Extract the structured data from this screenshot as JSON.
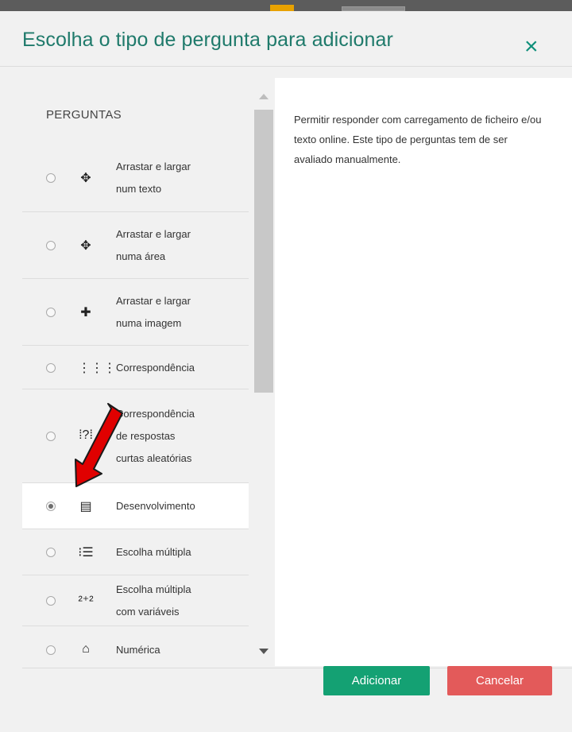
{
  "dialog": {
    "title": "Escolha o tipo de pergunta para adicionar",
    "close_symbol": "×"
  },
  "left_pane": {
    "section_title": "PERGUNTAS",
    "items": [
      {
        "label": "Arrastar e largar num texto",
        "lines": [
          "Arrastar e largar",
          "num texto"
        ],
        "icon": "move-icon",
        "icon_glyph": "✥",
        "selected": false
      },
      {
        "label": "Arrastar e largar numa área",
        "lines": [
          "Arrastar e largar",
          "numa área"
        ],
        "icon": "move-icon",
        "icon_glyph": "✥",
        "selected": false
      },
      {
        "label": "Arrastar e largar numa imagem",
        "lines": [
          "Arrastar e largar",
          "numa imagem"
        ],
        "icon": "move-icon",
        "icon_glyph": "✚",
        "selected": false
      },
      {
        "label": "Correspondência",
        "lines": [
          "Correspondência"
        ],
        "icon": "matching-icon",
        "icon_glyph": "⋮⋮⋮",
        "selected": false
      },
      {
        "label": "Correspondência de respostas curtas aleatórias",
        "lines": [
          "Correspondência",
          "de respostas",
          "curtas aleatórias"
        ],
        "icon": "random-matching-icon",
        "icon_glyph": "⁞?⁞",
        "selected": false
      },
      {
        "label": "Desenvolvimento",
        "lines": [
          "Desenvolvimento"
        ],
        "icon": "essay-icon",
        "icon_glyph": "▤",
        "selected": true
      },
      {
        "label": "Escolha múltipla",
        "lines": [
          "Escolha múltipla"
        ],
        "icon": "multichoice-icon",
        "icon_glyph": "⁝☰",
        "selected": false
      },
      {
        "label": "Escolha múltipla com variáveis",
        "lines": [
          "Escolha múltipla",
          "com variáveis"
        ],
        "icon": "calculated-multichoice-icon",
        "icon_glyph": "²⁺²",
        "selected": false
      },
      {
        "label": "Numérica",
        "lines": [
          "Numérica"
        ],
        "icon": "numerical-icon",
        "icon_glyph": "⌂",
        "selected": false
      }
    ]
  },
  "right_pane": {
    "description": "Permitir responder com carregamento de ficheiro e/ou texto online. Este tipo de perguntas tem de ser avaliado manualmente."
  },
  "footer": {
    "add_label": "Adicionar",
    "cancel_label": "Cancelar"
  },
  "colors": {
    "title": "#1f7a6b",
    "add_button": "#14a173",
    "cancel_button": "#e35a5a",
    "annotation_arrow": "#e00000"
  }
}
